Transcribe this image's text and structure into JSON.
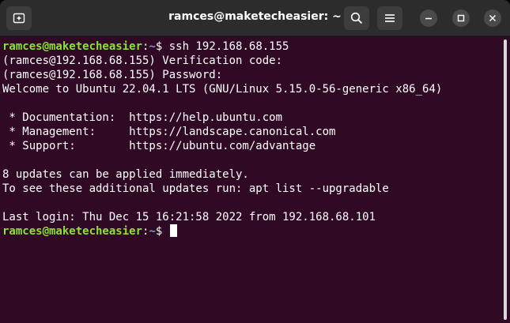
{
  "window": {
    "title": "ramces@maketecheasier: ~"
  },
  "icons": {
    "new_tab": "new-tab-icon",
    "search": "search-icon",
    "menu": "hamburger-menu-icon",
    "minimize": "minimize-icon",
    "maximize": "maximize-icon",
    "close": "close-icon"
  },
  "colors": {
    "background": "#300a24",
    "titlebar": "#2c2c2c",
    "prompt_user": "#8ae234",
    "prompt_path": "#729fcf",
    "text": "#ffffff"
  },
  "terminal": {
    "prompt1": {
      "user_host": "ramces@maketecheasier",
      "sep": ":",
      "path": "~",
      "symbol": "$ ",
      "command": "ssh 192.168.68.155"
    },
    "lines": [
      "(ramces@192.168.68.155) Verification code:",
      "(ramces@192.168.68.155) Password:",
      "Welcome to Ubuntu 22.04.1 LTS (GNU/Linux 5.15.0-56-generic x86_64)",
      "",
      " * Documentation:  https://help.ubuntu.com",
      " * Management:     https://landscape.canonical.com",
      " * Support:        https://ubuntu.com/advantage",
      "",
      "8 updates can be applied immediately.",
      "To see these additional updates run: apt list --upgradable",
      "",
      "Last login: Thu Dec 15 16:21:58 2022 from 192.168.68.101"
    ],
    "prompt2": {
      "user_host": "ramces@maketecheasier",
      "sep": ":",
      "path": "~",
      "symbol": "$ "
    }
  }
}
